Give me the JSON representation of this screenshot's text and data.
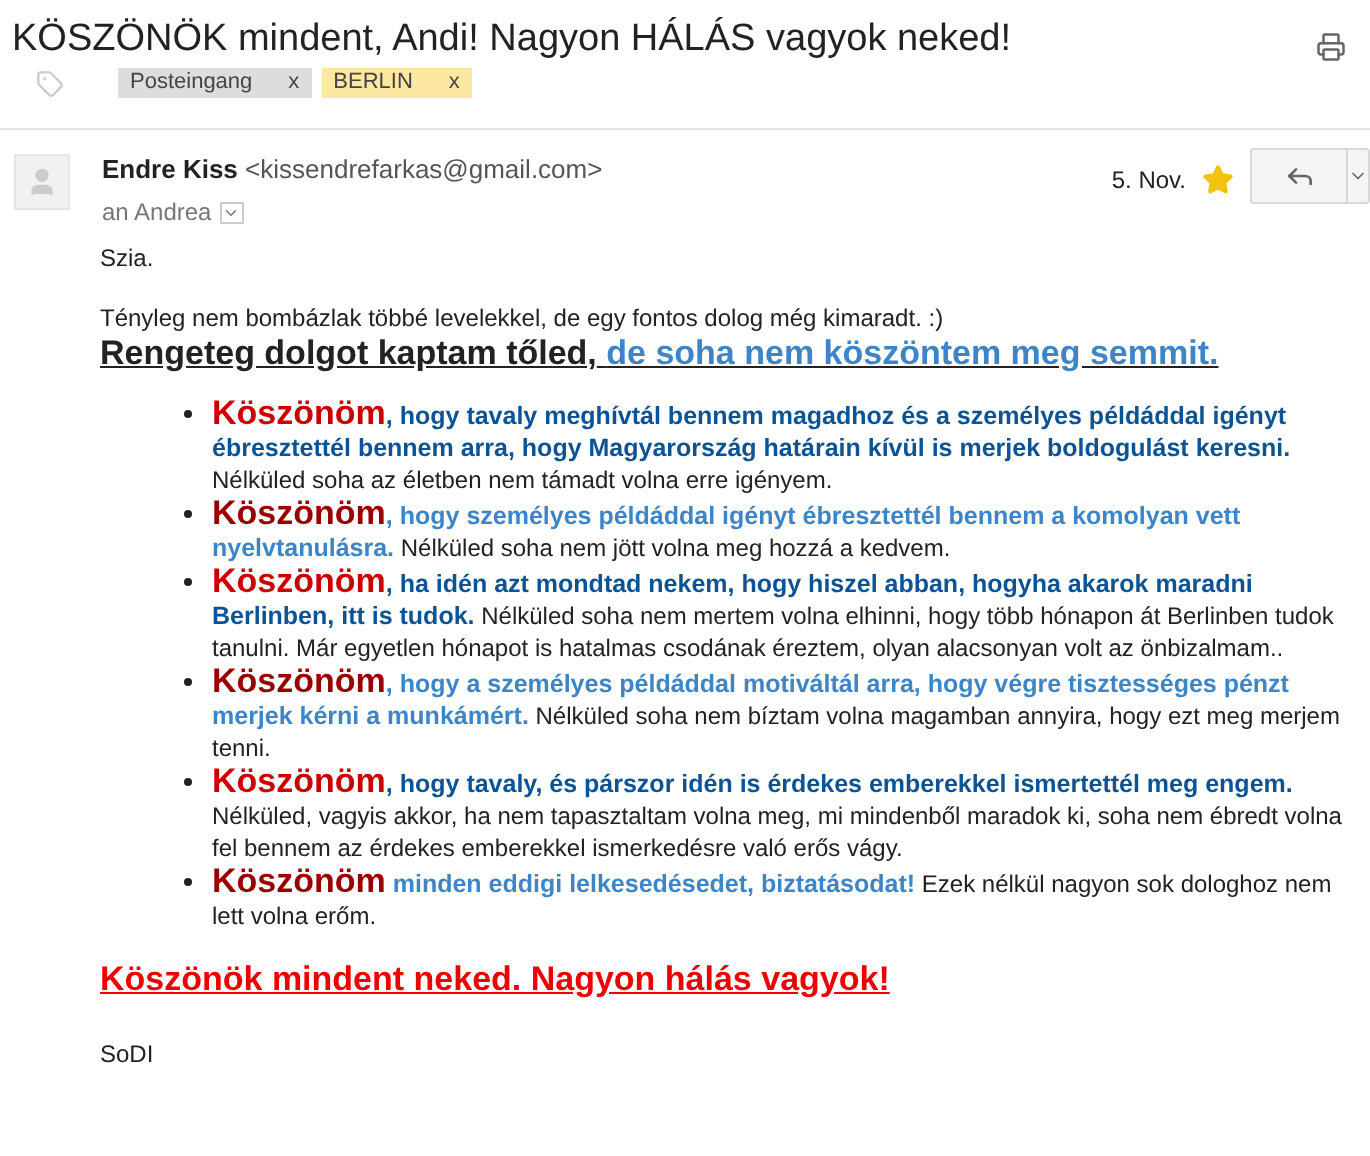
{
  "subject": "KÖSZÖNÖK mindent, Andi! Nagyon HÁLÁS vagyok neked!",
  "labels": [
    {
      "text": "Posteingang",
      "remove": "x",
      "color": "#dddddd"
    },
    {
      "text": "BERLIN",
      "remove": "x",
      "color": "#fce8a0"
    }
  ],
  "message": {
    "sender_name": "Endre Kiss",
    "sender_email": "<kissendrefarkas@gmail.com>",
    "recipient": "an Andrea",
    "date": "5. Nov.",
    "starred": true,
    "greeting": "Szia.",
    "intro": "Tényleg nem bombázlak többé levelekkel, de egy fontos dolog még kimaradt. :)",
    "headline": "Rengeteg dolgot kaptam tőled,",
    "headline_accent": "de soha nem köszöntem meg semmit.",
    "items": [
      {
        "thanks": "Köszönöm",
        "punct": ",",
        "color": "#cc0000",
        "kind": "dark",
        "highlight": "hogy tavaly meghívtál bennem magadhoz és a személyes példáddal igényt ébresztettél bennem arra, hogy Magyarország határain kívül is merjek boldogulást keresni.",
        "rest": "Nélküled soha az életben nem támadt volna erre igényem."
      },
      {
        "thanks": "Köszönöm",
        "punct": ",",
        "color": "#990000",
        "kind": "light",
        "highlight": "hogy személyes példáddal igényt ébresztettél bennem a komolyan vett nyelvtanulásra.",
        "rest": "Nélküled soha nem jött volna meg hozzá a kedvem."
      },
      {
        "thanks": "Köszönöm",
        "punct": ",",
        "color": "#cc0000",
        "kind": "dark",
        "highlight": "ha idén azt mondtad nekem, hogy hiszel abban, hogyha akarok maradni Berlinben, itt is tudok.",
        "rest": "Nélküled soha nem mertem volna elhinni, hogy több hónapon át Berlinben tudok tanulni. Már egyetlen hónapot is hatalmas csodának éreztem, olyan alacsonyan volt az önbizalmam.."
      },
      {
        "thanks": "Köszönöm",
        "punct": ",",
        "color": "#990000",
        "kind": "light",
        "highlight": "hogy a személyes példáddal motiváltál arra, hogy végre tisztességes pénzt merjek kérni a munkámért.",
        "rest": "Nélküled soha nem bíztam volna magamban annyira, hogy ezt meg merjem tenni."
      },
      {
        "thanks": "Köszönöm",
        "punct": ",",
        "color": "#cc0000",
        "kind": "dark",
        "highlight": "hogy tavaly, és párszor idén is érdekes emberekkel ismertettél meg engem.",
        "rest": "Nélküled, vagyis akkor, ha nem tapasztaltam volna meg, mi mindenből maradok ki, soha nem ébredt volna fel bennem az érdekes emberekkel ismerkedésre való erős vágy."
      },
      {
        "thanks": "Köszönöm",
        "color": "#990000",
        "kind": "light",
        "highlight": "minden eddigi lelkesedésedet, biztatásodat!",
        "rest": "Ezek nélkül nagyon sok dologhoz nem lett volna erőm."
      }
    ],
    "closing": "Köszönök mindent neked. Nagyon hálás vagyok!",
    "signature": "SoDI"
  }
}
